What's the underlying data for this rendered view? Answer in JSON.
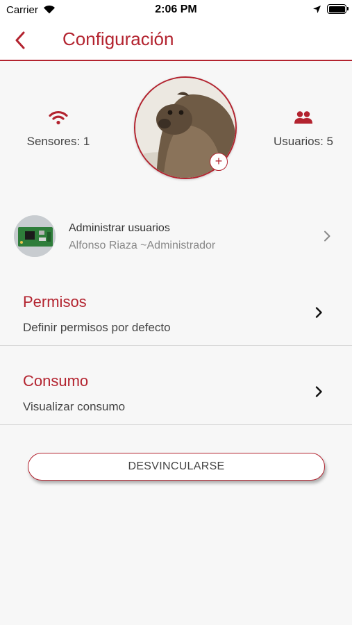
{
  "status_bar": {
    "carrier": "Carrier",
    "time": "2:06 PM"
  },
  "nav": {
    "title": "Configuración"
  },
  "stats": {
    "sensors_label": "Sensores: 1",
    "users_label": "Usuarios: 5"
  },
  "avatar": {
    "add_symbol": "+"
  },
  "admin": {
    "title": "Administrar usuarios",
    "subtitle": "Alfonso Riaza ~Administrador"
  },
  "rows": [
    {
      "title": "Permisos",
      "subtitle": "Definir permisos por defecto"
    },
    {
      "title": "Consumo",
      "subtitle": "Visualizar consumo"
    }
  ],
  "unlink_label": "DESVINCULARSE",
  "colors": {
    "accent": "#b3232f",
    "background": "#f7f7f7"
  },
  "icons": [
    "wifi-icon",
    "location-icon",
    "battery-icon",
    "back-chevron-icon",
    "users-icon",
    "chevron-right-icon"
  ]
}
